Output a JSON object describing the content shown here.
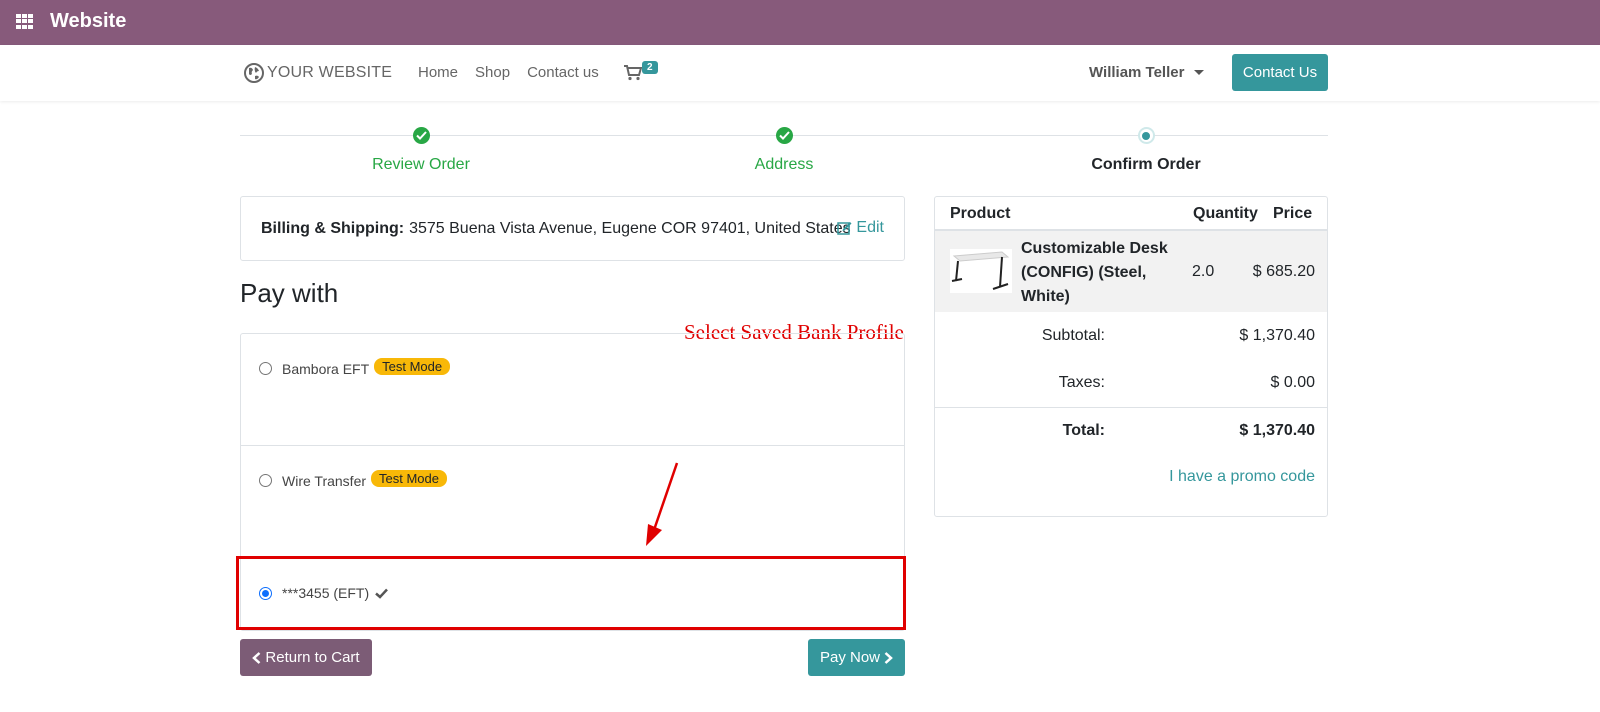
{
  "app_bar": {
    "title": "Website"
  },
  "header": {
    "logo_text": "YOUR WEBSITE",
    "nav": [
      "Home",
      "Shop",
      "Contact us"
    ],
    "cart_count": "2",
    "user_name": "William Teller",
    "contact_button": "Contact Us"
  },
  "wizard": {
    "steps": [
      {
        "label": "Review Order",
        "state": "done"
      },
      {
        "label": "Address",
        "state": "done"
      },
      {
        "label": "Confirm Order",
        "state": "active"
      }
    ]
  },
  "billing": {
    "label": "Billing & Shipping:",
    "address": "3575 Buena Vista Avenue, Eugene COR 97401, United States",
    "edit_label": "Edit"
  },
  "payment": {
    "heading": "Pay with",
    "options": [
      {
        "label": "Bambora EFT",
        "badge": "Test Mode",
        "selected": false
      },
      {
        "label": "Wire Transfer",
        "badge": "Test Mode",
        "selected": false
      },
      {
        "label": "***3455 (EFT)",
        "selected": true
      }
    ],
    "annotation": "Select Saved Bank Profile"
  },
  "buttons": {
    "return_to_cart": "Return to Cart",
    "pay_now": "Pay Now"
  },
  "order_summary": {
    "headers": {
      "product": "Product",
      "quantity": "Quantity",
      "price": "Price"
    },
    "items": [
      {
        "name": "Customizable Desk (CONFIG) (Steel, White)",
        "quantity": "2.0",
        "price": "$ 685.20"
      }
    ],
    "subtotal_label": "Subtotal:",
    "subtotal": "$ 1,370.40",
    "taxes_label": "Taxes:",
    "taxes": "$ 0.00",
    "total_label": "Total:",
    "total": "$ 1,370.40",
    "promo_link": "I have a promo code"
  },
  "colors": {
    "app_bar": "#875a7b",
    "primary": "#35979c",
    "success": "#28a745",
    "badge": "#f8b808",
    "annotation": "#e00000",
    "secondary_button": "#7c5c76"
  }
}
